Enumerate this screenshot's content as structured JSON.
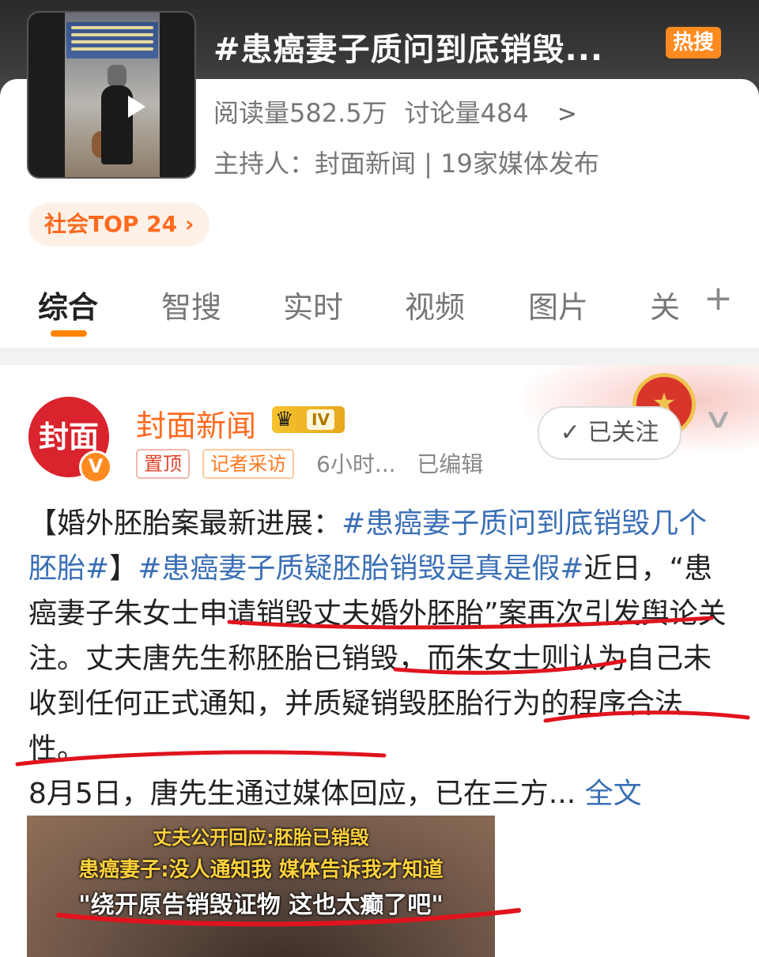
{
  "header": {
    "title": "#患癌妻子质问到底销毁...",
    "hot_badge": "热搜",
    "reads": "阅读量582.5万",
    "discussions": "讨论量484",
    "host": "主持人：封面新闻 | 19家媒体发布",
    "top_pill": "社会TOP 24 ›"
  },
  "tabs": [
    {
      "label": "综合"
    },
    {
      "label": "智搜"
    },
    {
      "label": "实时"
    },
    {
      "label": "视频"
    },
    {
      "label": "图片"
    },
    {
      "label": "关"
    }
  ],
  "post": {
    "author": "封面新闻",
    "avatar_text": "封面",
    "verify_mark": "V",
    "level": "IV",
    "tag_pinned": "置顶",
    "tag_reporter": "记者采访",
    "time": "6小时...",
    "edited": "已编辑",
    "follow": "✓ 已关注",
    "text": {
      "bracket_open": "【婚外胚胎案最新进展：",
      "topic1": "#患癌妻子质问到底销毁几个胚胎#",
      "bracket_close": "】",
      "topic2": "#患癌妻子质疑胚胎销毁是真是假#",
      "body": "近日，“患癌妻子朱女士申请销毁丈夫婚外胚胎”案再次引发舆论关注。丈夫唐先生称胚胎已销毁，而朱女士则认为自己未收到任何正式通知，并质疑销毁胚胎行为的程序合法性。",
      "body2": "8月5日，唐先生通过媒体回应，已在三方...",
      "more": "全文"
    },
    "video": {
      "caption1": "丈夫公开回应:胚胎已销毁",
      "caption2": "患癌妻子:没人通知我 媒体告诉我才知道",
      "caption3": "\"绕开原告销毁证物 这也太癫了吧\""
    }
  },
  "colors": {
    "accent": "#ff8200",
    "topic_blue": "#3a6fb5",
    "annotation_red": "#e0141e"
  }
}
